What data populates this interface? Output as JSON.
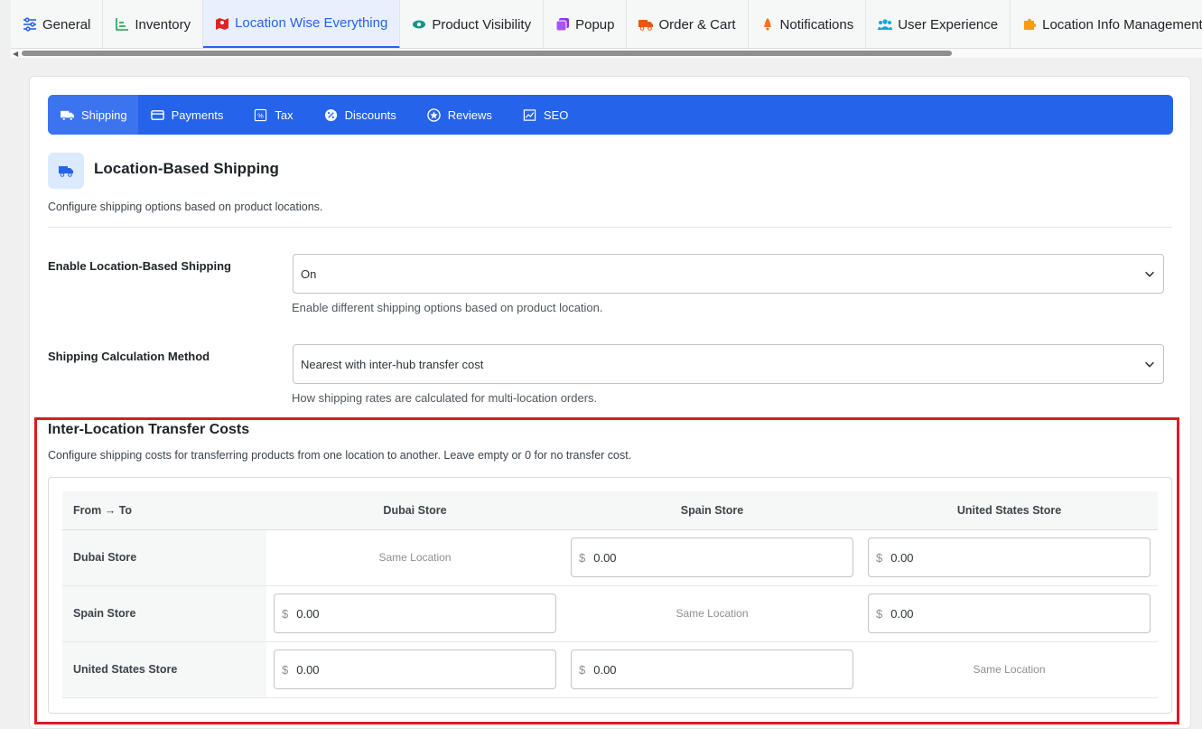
{
  "top_tabs": [
    {
      "label": "General",
      "icon": "sliders-icon"
    },
    {
      "label": "Inventory",
      "icon": "chart-icon"
    },
    {
      "label": "Location Wise Everything",
      "icon": "map-icon"
    },
    {
      "label": "Product Visibility",
      "icon": "eye-icon"
    },
    {
      "label": "Popup",
      "icon": "popup-icon"
    },
    {
      "label": "Order & Cart",
      "icon": "truck-icon"
    },
    {
      "label": "Notifications",
      "icon": "bell-icon"
    },
    {
      "label": "User Experience",
      "icon": "users-icon"
    },
    {
      "label": "Location Info Management",
      "icon": "puzzle-icon"
    }
  ],
  "sub_nav": [
    {
      "label": "Shipping",
      "icon": "truck-icon"
    },
    {
      "label": "Payments",
      "icon": "card-icon"
    },
    {
      "label": "Tax",
      "icon": "percent-icon"
    },
    {
      "label": "Discounts",
      "icon": "badge-percent-icon"
    },
    {
      "label": "Reviews",
      "icon": "star-icon"
    },
    {
      "label": "SEO",
      "icon": "chart-icon"
    }
  ],
  "section": {
    "title": "Location-Based Shipping",
    "description": "Configure shipping options based on product locations."
  },
  "fields": {
    "enable": {
      "label": "Enable Location-Based Shipping",
      "value": "On",
      "help": "Enable different shipping options based on product location."
    },
    "method": {
      "label": "Shipping Calculation Method",
      "value": "Nearest with inter-hub transfer cost",
      "help": "How shipping rates are calculated for multi-location orders."
    }
  },
  "transfer": {
    "title": "Inter-Location Transfer Costs",
    "description": "Configure shipping costs for transferring products from one location to another. Leave empty or 0 for no transfer cost.",
    "corner_header": "From → To",
    "currency": "$",
    "same_label": "Same Location",
    "locations": [
      "Dubai Store",
      "Spain Store",
      "United States Store"
    ],
    "costs": [
      [
        null,
        "0.00",
        "0.00"
      ],
      [
        "0.00",
        null,
        "0.00"
      ],
      [
        "0.00",
        "0.00",
        null
      ]
    ]
  },
  "colors": {
    "accent": "#2563eb",
    "highlight_border": "#d91c24"
  }
}
